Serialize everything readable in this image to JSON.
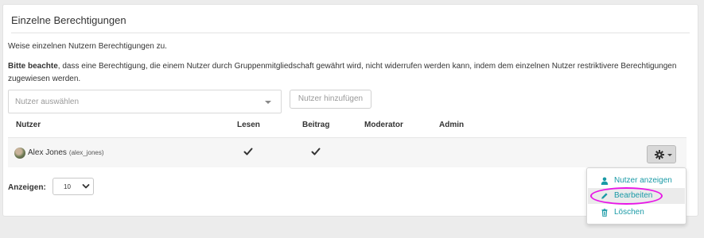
{
  "panel": {
    "title": "Einzelne Berechtigungen",
    "intro": "Weise einzelnen Nutzern Berechtigungen zu.",
    "note_strong": "Bitte beachte",
    "note_rest": ", dass eine Berechtigung, die einem Nutzer durch Gruppenmitgliedschaft gewährt wird, nicht widerrufen werden kann, indem dem einzelnen Nutzer restriktivere Berechtigungen zugewiesen werden."
  },
  "user_picker": {
    "placeholder": "Nutzer auswählen",
    "add_label": "Nutzer hinzufügen"
  },
  "table": {
    "headers": {
      "user": "Nutzer",
      "read": "Lesen",
      "post": "Beitrag",
      "moderator": "Moderator",
      "admin": "Admin"
    },
    "rows": [
      {
        "name": "Alex Jones",
        "handle": "(alex_jones)",
        "read": true,
        "post": true,
        "moderator": false,
        "admin": false
      }
    ]
  },
  "pagination": {
    "label": "Anzeigen:",
    "value": "10"
  },
  "action_menu": {
    "items": [
      {
        "label": "Nutzer anzeigen",
        "icon": "user-icon"
      },
      {
        "label": "Bearbeiten",
        "icon": "pencil-icon"
      },
      {
        "label": "Löschen",
        "icon": "trash-icon"
      }
    ],
    "highlighted_item": "Bearbeiten"
  },
  "colors": {
    "accent": "#1a9aa6",
    "highlight_ring": "#e716e6",
    "row_background": "#f6f6f6",
    "page_background": "#ececec"
  }
}
